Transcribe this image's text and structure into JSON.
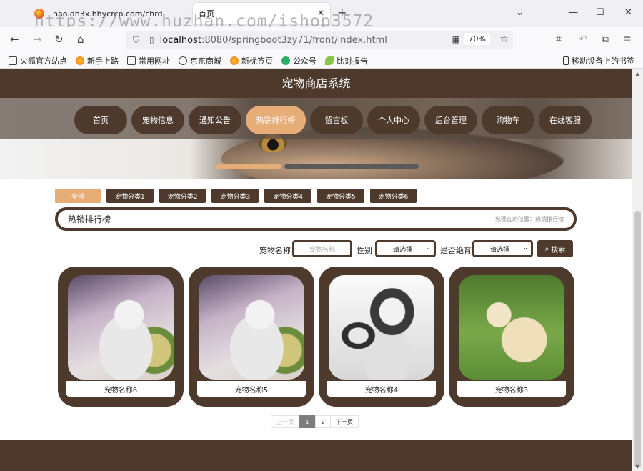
{
  "browser": {
    "tabs": [
      {
        "title": "hao.dh3x.hhycrcp.com/chrd"
      },
      {
        "title": "首页"
      }
    ],
    "url_host": "localhost",
    "url_rest": ":8080/springboot3zy71/front/index.html",
    "zoom": "70%",
    "bookmarks": [
      "火狐官方站点",
      "新手上路",
      "常用网址",
      "京东商城",
      "新标签页",
      "公众号",
      "比对报告"
    ],
    "mobile_bookmarks": "移动设备上的书签"
  },
  "watermark": "https://www.huzhan.com/ishop3572",
  "site": {
    "title": "宠物商店系统",
    "nav": [
      "首页",
      "宠物信息",
      "通知公告",
      "热销排行榜",
      "留言板",
      "个人中心",
      "后台管理",
      "购物车",
      "在线客服"
    ],
    "active_nav_index": 3,
    "categories": [
      "全部",
      "宠物分类1",
      "宠物分类2",
      "宠物分类3",
      "宠物分类4",
      "宠物分类5",
      "宠物分类6"
    ],
    "section_title": "热销排行榜",
    "location": "您现在的位置：热销排行榜",
    "search": {
      "name_label": "宠物名称",
      "name_placeholder": "宠物名称",
      "gender_label": "性别",
      "gender_value": "请选择",
      "sterilized_label": "是否绝育",
      "sterilized_value": "请选择",
      "button": "搜索"
    },
    "products": [
      {
        "name": "宠物名称6",
        "image": "kitten"
      },
      {
        "name": "宠物名称5",
        "image": "kitten"
      },
      {
        "name": "宠物名称4",
        "image": "husky"
      },
      {
        "name": "宠物名称3",
        "image": "lab"
      }
    ],
    "pager": {
      "prev": "上一页",
      "pages": [
        "1",
        "2"
      ],
      "current": "1",
      "next": "下一页"
    }
  },
  "colors": {
    "brand": "#4d3a2d",
    "accent": "#e7ad77"
  }
}
